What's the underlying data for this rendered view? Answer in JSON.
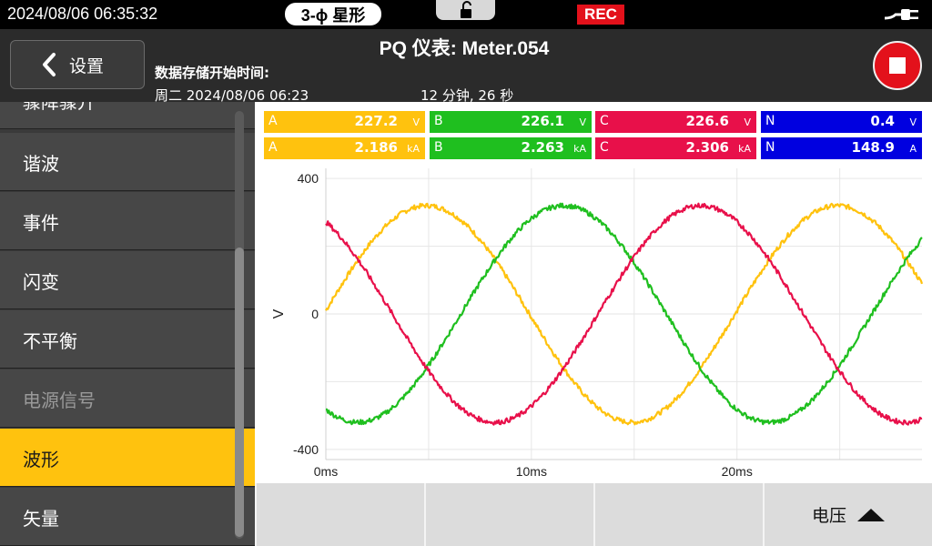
{
  "status": {
    "datetime": "2024/08/06  06:35:32",
    "mode": "3-ϕ 星形",
    "rec": "REC",
    "lock_icon": "unlock-icon",
    "power_icon": "plug-icon"
  },
  "header": {
    "back_label": "设置",
    "title": "PQ 仪表: Meter.054",
    "storage_label": "数据存储开始时间:",
    "storage_start": "周二 2024/08/06 06:23",
    "storage_duration": "12 分钟, 26 秒"
  },
  "sidebar": {
    "items": [
      {
        "label": "骤降骤升"
      },
      {
        "label": "谐波"
      },
      {
        "label": "事件"
      },
      {
        "label": "闪变"
      },
      {
        "label": "不平衡"
      },
      {
        "label": "电源信号"
      },
      {
        "label": "波形"
      },
      {
        "label": "矢量"
      }
    ]
  },
  "readouts": {
    "voltage": [
      {
        "phase": "A",
        "value": "227.2",
        "unit": "V"
      },
      {
        "phase": "B",
        "value": "226.1",
        "unit": "V"
      },
      {
        "phase": "C",
        "value": "226.6",
        "unit": "V"
      },
      {
        "phase": "N",
        "value": "0.4",
        "unit": "V"
      }
    ],
    "current": [
      {
        "phase": "A",
        "value": "2.186",
        "unit": "kA"
      },
      {
        "phase": "B",
        "value": "2.263",
        "unit": "kA"
      },
      {
        "phase": "C",
        "value": "2.306",
        "unit": "kA"
      },
      {
        "phase": "N",
        "value": "148.9",
        "unit": "A"
      }
    ]
  },
  "colors": {
    "A": "#ffc20e",
    "B": "#1fbf1f",
    "C": "#e8104a",
    "N": "#0000e0",
    "active_menu": "#ffc20e",
    "rec": "#e3111b"
  },
  "chart_data": {
    "type": "line",
    "xlabel": "",
    "ylabel": "V",
    "xlim": [
      0,
      29
    ],
    "ylim": [
      -430,
      430
    ],
    "x_ticks": [
      {
        "value": 0,
        "label": "0ms"
      },
      {
        "value": 10,
        "label": "10ms"
      },
      {
        "value": 20,
        "label": "20ms"
      }
    ],
    "y_ticks": [
      {
        "value": 400,
        "label": "400"
      },
      {
        "value": 0,
        "label": "0"
      },
      {
        "value": -400,
        "label": "-400"
      }
    ],
    "grid": true,
    "series": [
      {
        "name": "A",
        "amplitude": 320,
        "frequency_hz": 50,
        "phase_deg": 0,
        "color": "#ffc20e"
      },
      {
        "name": "B",
        "amplitude": 320,
        "frequency_hz": 50,
        "phase_deg": -120,
        "color": "#1fbf1f"
      },
      {
        "name": "C",
        "amplitude": 320,
        "frequency_hz": 50,
        "phase_deg": 120,
        "color": "#e8104a"
      }
    ]
  },
  "bottom": {
    "voltage_label": "电压"
  }
}
